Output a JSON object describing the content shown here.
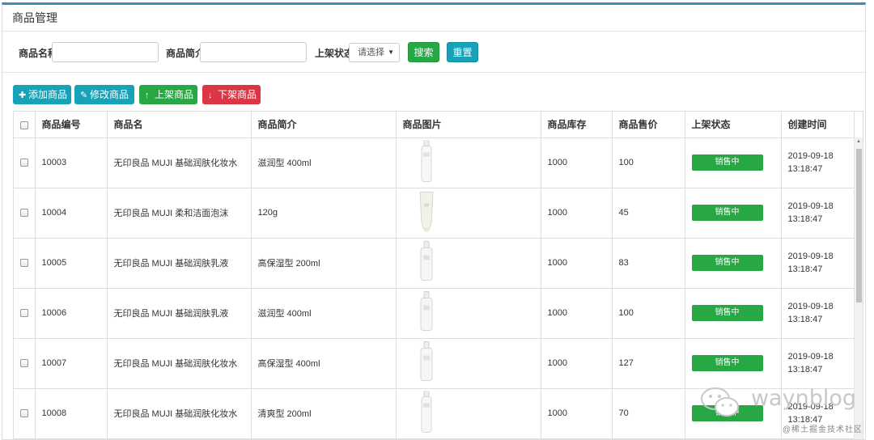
{
  "panel": {
    "title": "商品管理"
  },
  "search": {
    "name_label": "商品名称",
    "name_value": "",
    "intro_label": "商品简介",
    "intro_value": "",
    "status_label": "上架状态",
    "status_selected": "请选择",
    "search_button": "搜索",
    "reset_button": "重置"
  },
  "toolbar": {
    "add": "添加商品",
    "edit": "修改商品",
    "up": "上架商品",
    "down": "下架商品"
  },
  "table": {
    "headers": [
      "商品编号",
      "商品名",
      "商品简介",
      "商品图片",
      "商品库存",
      "商品售价",
      "上架状态",
      "创建时间"
    ],
    "rows": [
      {
        "id": "10003",
        "name": "无印良品 MUJI 基础润肤化妆水",
        "intro": "滋润型 400ml",
        "image": "tall-bottle",
        "stock": "1000",
        "price": "100",
        "status": "销售中",
        "date": "2019-09-18",
        "time": "13:18:47"
      },
      {
        "id": "10004",
        "name": "无印良品 MUJI 柔和洁面泡沫",
        "intro": "120g",
        "image": "tube",
        "stock": "1000",
        "price": "45",
        "status": "销售中",
        "date": "2019-09-18",
        "time": "13:18:47"
      },
      {
        "id": "10005",
        "name": "无印良品 MUJI 基础润肤乳液",
        "intro": "高保湿型 200ml",
        "image": "short-bottle",
        "stock": "1000",
        "price": "83",
        "status": "销售中",
        "date": "2019-09-18",
        "time": "13:18:47"
      },
      {
        "id": "10006",
        "name": "无印良品 MUJI 基础润肤乳液",
        "intro": "滋润型 400ml",
        "image": "short-bottle",
        "stock": "1000",
        "price": "100",
        "status": "销售中",
        "date": "2019-09-18",
        "time": "13:18:47"
      },
      {
        "id": "10007",
        "name": "无印良品 MUJI 基础润肤化妆水",
        "intro": "高保湿型 400ml",
        "image": "short-bottle",
        "stock": "1000",
        "price": "127",
        "status": "销售中",
        "date": "2019-09-18",
        "time": "13:18:47"
      },
      {
        "id": "10008",
        "name": "无印良品 MUJI 基础润肤化妆水",
        "intro": "清爽型 200ml",
        "image": "tall-bottle",
        "stock": "1000",
        "price": "70",
        "status": "销售中",
        "date": "2019-09-18",
        "time": "13:18:47"
      }
    ]
  },
  "watermark": {
    "text": "waynblog",
    "sub": "@稀土掘金技术社区"
  },
  "colors": {
    "accent": "#3c8dbc",
    "success": "#28a745",
    "info": "#17a2b8",
    "danger": "#dc3545"
  },
  "icons": {
    "add": "plus-icon",
    "edit": "edit-icon",
    "up": "arrow-up-icon",
    "down": "arrow-down-icon"
  }
}
